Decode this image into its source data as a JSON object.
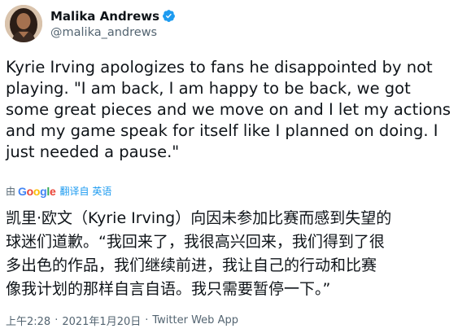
{
  "author": {
    "display_name": "Malika Andrews",
    "handle": "@malika_andrews",
    "verified_icon": "verified-badge-icon"
  },
  "tweet": {
    "text_en": "Kyrie Irving apologizes to fans he disappointed by not\nplaying. \"I am back, I am happy to be back, we got\nsome great pieces and we move on and I let my actions\nand my game speak for itself like I planned on doing. I\njust needed a pause.\"",
    "translate_by": "由",
    "translate_provider": "Google",
    "translate_label": "翻译自 英语",
    "text_zh": "凯里·欧文（Kyrie Irving）向因未参加比赛而感到失望的\n球迷们道歉。“我回来了，我很高兴回来，我们得到了很\n多出色的作品，我们继续前进，我让自己的行动和比赛\n像我计划的那样自言自语。我只需要暂停一下。”"
  },
  "meta": {
    "time": "上午2:28",
    "separator": "·",
    "date": "2021年1月20日",
    "app": "Twitter Web App"
  },
  "colors": {
    "verified": "#1d9bf0",
    "link": "#1d9bf0",
    "secondary_text": "#536471"
  }
}
